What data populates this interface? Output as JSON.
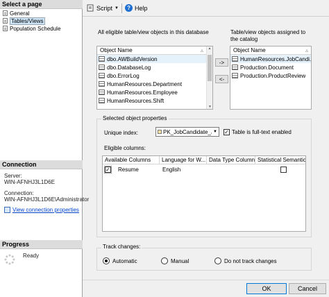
{
  "left": {
    "select_page_header": "Select a page",
    "pages": [
      {
        "label": "General"
      },
      {
        "label": "Tables/Views"
      },
      {
        "label": "Population Schedule"
      }
    ],
    "connection_header": "Connection",
    "server_label": "Server:",
    "server_value": "WIN-AFNHJ3L1D6E",
    "connection_label": "Connection:",
    "connection_value": "WIN-AFNHJ3L1D6E\\Administrator",
    "view_connection_link": "View connection properties",
    "progress_header": "Progress",
    "progress_status": "Ready"
  },
  "toolbar": {
    "script_label": "Script",
    "help_label": "Help"
  },
  "eligible": {
    "heading": "All eligible table/view objects in this database",
    "column_header": "Object Name",
    "items": [
      "dbo.AWBuildVersion",
      "dbo.DatabaseLog",
      "dbo.ErrorLog",
      "HumanResources.Department",
      "HumanResources.Employee",
      "HumanResources.Shift"
    ]
  },
  "assigned": {
    "heading": "Table/view objects assigned to the catalog",
    "column_header": "Object Name",
    "items": [
      "HumanResources.JobCandi...",
      "Production.Document",
      "Production.ProductReview"
    ]
  },
  "move_right_label": "->",
  "move_left_label": "<-",
  "properties": {
    "group_label": "Selected object properties",
    "unique_index_label": "Unique index:",
    "unique_index_value": "PK_JobCandidate_JobC",
    "full_text_enabled_label": "Table is full-text enabled",
    "eligible_columns_label": "Eligible columns:",
    "columns_headers": [
      "Available Columns",
      "Language for W...",
      "Data Type Column",
      "Statistical Semantics"
    ],
    "rows": [
      {
        "column": "Resume",
        "language": "English"
      }
    ]
  },
  "track": {
    "label": "Track changes:",
    "options": [
      "Automatic",
      "Manual",
      "Do not track changes"
    ]
  },
  "footer": {
    "ok_label": "OK",
    "cancel_label": "Cancel"
  }
}
